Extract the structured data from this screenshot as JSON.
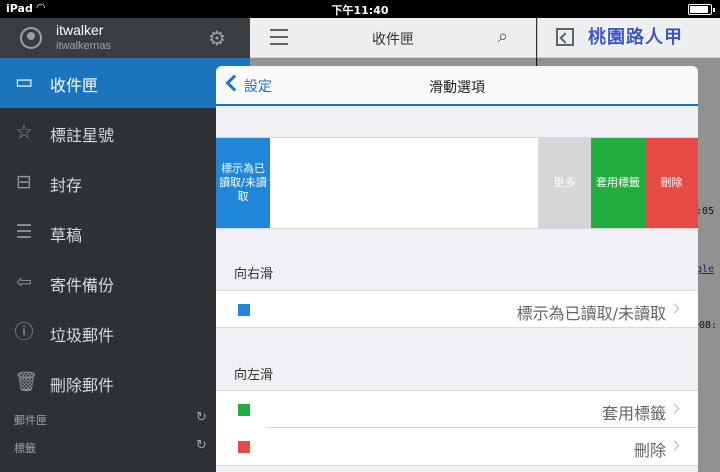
{
  "status": {
    "carrier": "iPad",
    "time": "下午11:40"
  },
  "account": {
    "name": "itwalker",
    "email": "itwalkernas"
  },
  "sidebar": {
    "items": [
      {
        "label": "收件匣",
        "icon": "inbox-icon"
      },
      {
        "label": "標註星號",
        "icon": "star-icon"
      },
      {
        "label": "封存",
        "icon": "archive-icon"
      },
      {
        "label": "草稿",
        "icon": "draft-icon"
      },
      {
        "label": "寄件備份",
        "icon": "sent-icon"
      },
      {
        "label": "垃圾郵件",
        "icon": "spam-icon"
      },
      {
        "label": "刪除郵件",
        "icon": "trash-icon"
      }
    ],
    "sections": [
      {
        "label": "郵件匣"
      },
      {
        "label": "標籤"
      }
    ]
  },
  "list_header": {
    "title": "收件匣"
  },
  "watermark": "桃園路人甲",
  "reading_peek": [
    ":05",
    "gle",
    "+08:"
  ],
  "modal": {
    "back_label": "設定",
    "title": "滑動選項",
    "preview_actions": {
      "read": "標示為已讀取/未讀取",
      "more": "更多",
      "label": "套用標籤",
      "delete": "刪除"
    },
    "swipe_right": {
      "header": "向右滑",
      "rows": [
        {
          "value": "標示為已讀取/未讀取",
          "color": "#1f86d8"
        }
      ]
    },
    "swipe_left": {
      "header": "向左滑",
      "rows": [
        {
          "value": "套用標籤",
          "color": "#22ad3f"
        },
        {
          "value": "刪除",
          "color": "#e64a45"
        }
      ]
    }
  },
  "colors": {
    "accent": "#1c74bd",
    "read": "#1f86d8",
    "label": "#22ad3f",
    "delete": "#e64a45"
  }
}
